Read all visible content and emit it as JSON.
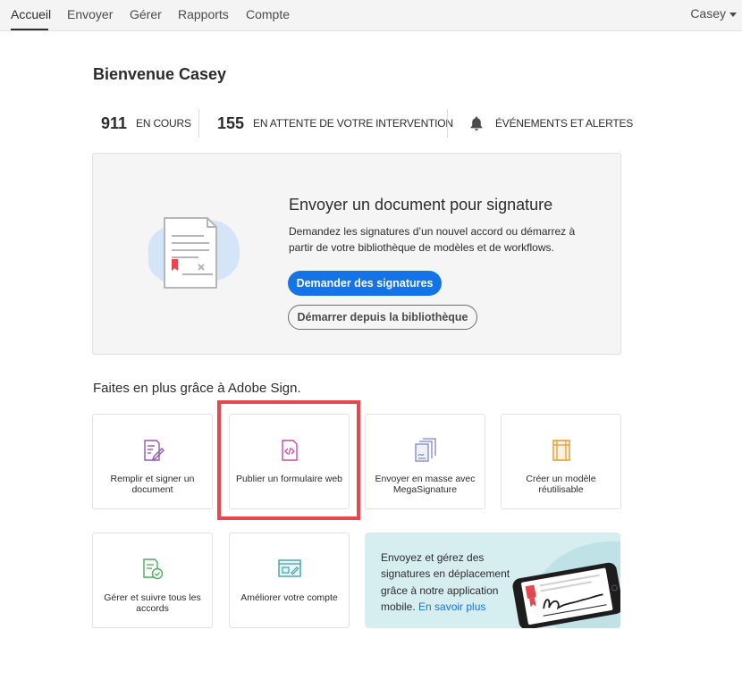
{
  "nav": {
    "tabs": [
      {
        "label": "Accueil"
      },
      {
        "label": "Envoyer"
      },
      {
        "label": "Gérer"
      },
      {
        "label": "Rapports"
      },
      {
        "label": "Compte"
      }
    ],
    "active_tab": "Accueil",
    "user": "Casey"
  },
  "welcome": "Bienvenue Casey",
  "stats": {
    "in_progress": {
      "count": "911",
      "label": "EN COURS"
    },
    "waiting": {
      "count": "155",
      "label": "EN ATTENTE DE VOTRE INTERVENTION"
    },
    "events": {
      "label": "ÉVÉNEMENTS ET ALERTES",
      "icon": "bell-icon"
    }
  },
  "send_panel": {
    "title": "Envoyer un document pour signature",
    "description": "Demandez les signatures d’un nouvel accord ou démarrez à partir de votre bibliothèque de modèles et de workflows.",
    "primary_button": "Demander des signatures",
    "secondary_button": "Démarrer depuis la bibliothèque"
  },
  "more_title": "Faites en plus grâce à Adobe Sign.",
  "cards": [
    {
      "label": "Remplir et signer un document",
      "icon": "fill-sign-icon",
      "color": "#9356b8"
    },
    {
      "label": "Publier un formulaire web",
      "icon": "web-form-icon",
      "color": "#c94aa5",
      "highlighted": true
    },
    {
      "label": "Envoyer en masse avec MegaSignature",
      "icon": "megasign-icon",
      "color": "#7a85c6"
    },
    {
      "label": "Créer un modèle réutilisable",
      "icon": "template-icon",
      "color": "#e49a2c"
    },
    {
      "label": "Gérer et suivre tous les accords",
      "icon": "manage-icon",
      "color": "#4caa5a"
    },
    {
      "label": "Améliorer votre compte",
      "icon": "upgrade-icon",
      "color": "#3ea3a8"
    }
  ],
  "mobile_card": {
    "text": "Envoyez et gérez des signatures en déplacement grâce à notre application mobile.",
    "link": "En savoir plus"
  },
  "colors": {
    "accent": "#1473e6",
    "highlight": "#e8484d",
    "mobile_bg": "#d6eef0"
  }
}
